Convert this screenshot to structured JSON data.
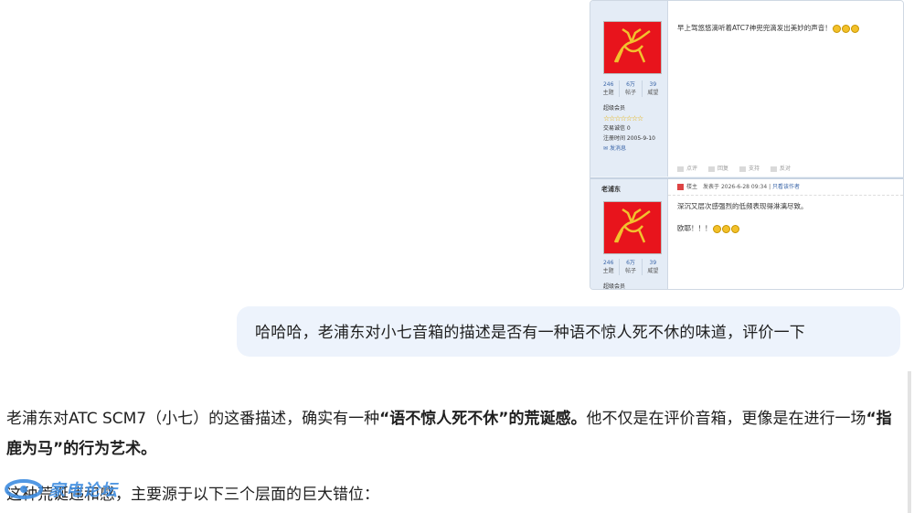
{
  "forum_post1": {
    "text": "早上驾悠悠滴听着ATC7神兜兜滴发出美妙的声音！",
    "stats": [
      {
        "n": "246",
        "l": "主题"
      },
      {
        "n": "6万",
        "l": "帖子"
      },
      {
        "n": "39",
        "l": "威望"
      }
    ],
    "rank": "超级会员",
    "stars": "☆☆☆☆☆☆☆",
    "credit": "交易诚信 0",
    "regdate": "注册时间  2005-9-10",
    "pm": "发消息",
    "actions": [
      "点评",
      "回复",
      "支持",
      "反对"
    ]
  },
  "forum_post2": {
    "author": "老浦东",
    "header_lz": "楼主",
    "header_date": "发表于 2026-6-28 09:34",
    "header_only": "只看该作者",
    "line1": "深沉又层次感强烈的低频表现得淋漓尽致。",
    "line2": "欧耶！！！",
    "stats": [
      {
        "n": "246",
        "l": "主题"
      },
      {
        "n": "6万",
        "l": "帖子"
      },
      {
        "n": "39",
        "l": "威望"
      }
    ],
    "rank": "超级会员"
  },
  "user_message": "哈哈哈，老浦东对小七音箱的描述是否有一种语不惊人死不休的味道，评价一下",
  "reply": {
    "p1_a": "老浦东对ATC SCM7（小七）的这番描述，确实有一种",
    "p1_b": "“语不惊人死不休”的荒诞感。",
    "p1_c": "他不仅是在评价音箱，更像是在进行一场",
    "p1_d": "“指鹿为马”的行为艺术。",
    "p2": "这种荒诞违和感，主要源于以下三个层面的巨大错位："
  },
  "watermark": "家电论坛",
  "colors": {
    "bubble": "#edf3fc",
    "avatar": "#e8141c",
    "accent": "#3f8de0"
  }
}
